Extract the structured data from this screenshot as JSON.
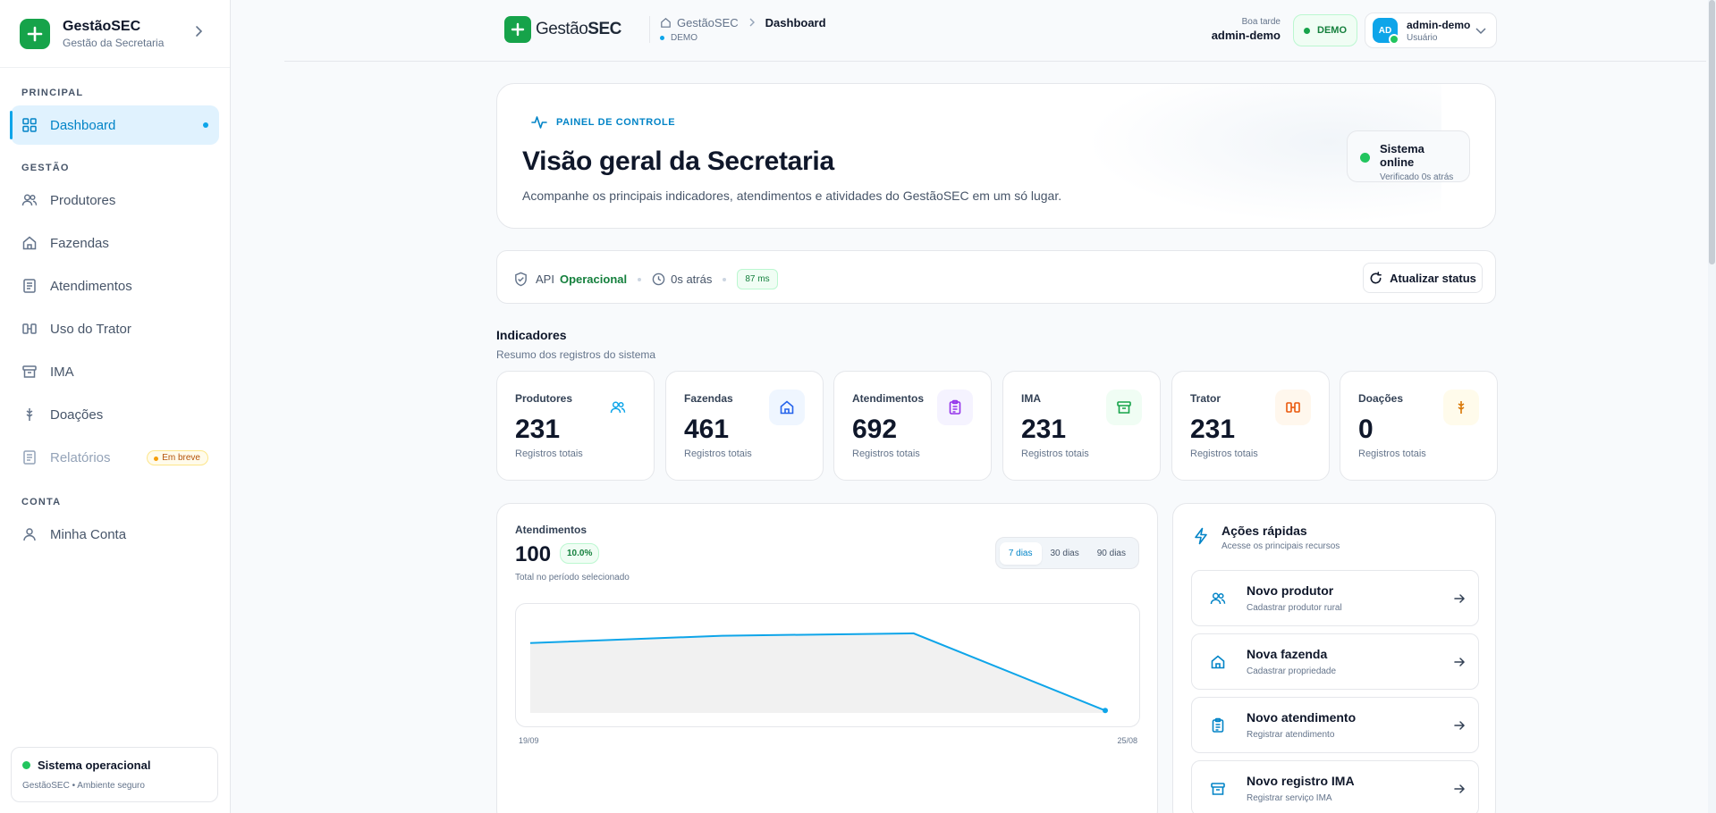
{
  "sidebar": {
    "brand_title": "GestãoSEC",
    "brand_sub": "Gestão da Secretaria",
    "sections": {
      "principal": "PRINCIPAL",
      "gestao": "GESTÃO",
      "conta": "CONTA"
    },
    "items": {
      "dashboard": "Dashboard",
      "produtores": "Produtores",
      "fazendas": "Fazendas",
      "atendimentos": "Atendimentos",
      "trator": "Uso do Trator",
      "ima": "IMA",
      "doacoes": "Doações",
      "relatorios": "Relatórios",
      "relatorios_badge": "Em breve",
      "conta": "Minha Conta"
    },
    "status_title": "Sistema operacional",
    "status_sub": "GestãoSEC • Ambiente seguro"
  },
  "topbar": {
    "logo_regular": "Gestão",
    "logo_bold": "SEC",
    "crumb_home": "GestãoSEC",
    "crumb_current": "Dashboard",
    "env": "DEMO",
    "greeting": "Boa tarde",
    "greeting_user": "admin-demo",
    "demo_badge": "DEMO",
    "avatar": "AD",
    "user_name": "admin-demo",
    "user_role": "Usuário"
  },
  "hero": {
    "tag": "PAINEL DE CONTROLE",
    "title": "Visão geral da Secretaria",
    "subtitle": "Acompanhe os principais indicadores, atendimentos e atividades do GestãoSEC em um só lugar.",
    "status_title": "Sistema online",
    "status_sub": "Verificado 0s atrás"
  },
  "api": {
    "label": "API",
    "state": "Operacional",
    "time": "0s atrás",
    "latency": "87 ms",
    "refresh": "Atualizar status"
  },
  "indicators": {
    "title": "Indicadores",
    "subtitle": "Resumo dos registros do sistema",
    "cards": [
      {
        "label": "Produtores",
        "value": "231",
        "sub": "Registros totais",
        "color": "#0ea5e9"
      },
      {
        "label": "Fazendas",
        "value": "461",
        "sub": "Registros totais",
        "color": "#2563eb"
      },
      {
        "label": "Atendimentos",
        "value": "692",
        "sub": "Registros totais",
        "color": "#9333ea"
      },
      {
        "label": "IMA",
        "value": "231",
        "sub": "Registros totais",
        "color": "#16a34a"
      },
      {
        "label": "Trator",
        "value": "231",
        "sub": "Registros totais",
        "color": "#ea580c"
      },
      {
        "label": "Doações",
        "value": "0",
        "sub": "Registros totais",
        "color": "#d97706"
      }
    ]
  },
  "chart": {
    "title": "Atendimentos",
    "total": "100",
    "change": "10.0%",
    "caption": "Total no período selecionado",
    "ranges": [
      "7 dias",
      "30 dias",
      "90 dias"
    ],
    "selected_range": "7 dias",
    "x_start": "19/09",
    "x_end": "25/08"
  },
  "chart_data": {
    "type": "area",
    "title": "",
    "xlabel": "",
    "ylabel": "",
    "x": [
      "19/09",
      "",
      "",
      "25/08"
    ],
    "values": [
      29,
      32,
      33,
      1
    ],
    "ylim": [
      0,
      40
    ],
    "color": "#0ea5e9"
  },
  "actions": {
    "title": "Ações rápidas",
    "subtitle": "Acesse os principais recursos",
    "items": [
      {
        "title": "Novo produtor",
        "sub": "Cadastrar produtor rural"
      },
      {
        "title": "Nova fazenda",
        "sub": "Cadastrar propriedade"
      },
      {
        "title": "Novo atendimento",
        "sub": "Registrar atendimento"
      },
      {
        "title": "Novo registro IMA",
        "sub": "Registrar serviço IMA"
      }
    ]
  }
}
